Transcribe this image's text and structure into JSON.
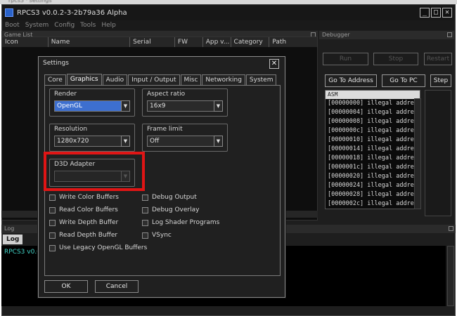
{
  "window": {
    "title": "RPCS3 v0.0.2-3-2b79a36 Alpha",
    "buttons": [
      "_",
      "□",
      "✕"
    ]
  },
  "menu": [
    "Boot",
    "System",
    "Config",
    "Tools",
    "Help"
  ],
  "game_list": {
    "header": "Game List",
    "columns": [
      "Icon",
      "Name",
      "Serial",
      "FW",
      "App v...",
      "Category",
      "Path"
    ]
  },
  "debugger": {
    "header": "Debugger",
    "run_label": "Run",
    "stop_label": "Stop",
    "restart_label": "Restart",
    "goto_address_label": "Go To Address",
    "goto_pc_label": "Go To PC",
    "step_label": "Step",
    "asm_header": "ASM",
    "asm_rows": [
      "[00000000] illegal addre",
      "[00000004] illegal addre",
      "[00000008] illegal addre",
      "[0000000c] illegal addre",
      "[00000010] illegal addre",
      "[00000014] illegal addre",
      "[00000018] illegal addre",
      "[0000001c] illegal addre",
      "[00000020] illegal addre",
      "[00000024] illegal addre",
      "[00000028] illegal addre",
      "[0000002c] illegal addre"
    ]
  },
  "log": {
    "header": "Log",
    "tab_label": "Log",
    "line": "RPCS3 v0.0.2"
  },
  "settings": {
    "title": "Settings",
    "close": "✕",
    "tabs": [
      "Core",
      "Graphics",
      "Audio",
      "Input / Output",
      "Misc",
      "Networking",
      "System"
    ],
    "active_tab": "Graphics",
    "render": {
      "label": "Render",
      "value": "OpenGL"
    },
    "aspect_ratio": {
      "label": "Aspect ratio",
      "value": "16x9"
    },
    "resolution": {
      "label": "Resolution",
      "value": "1280x720"
    },
    "frame_limit": {
      "label": "Frame limit",
      "value": "Off"
    },
    "d3d_adapter": {
      "label": "D3D Adapter",
      "value": ""
    },
    "checkboxes_left": [
      "Write Color Buffers",
      "Read Color Buffers",
      "Write Depth Buffer",
      "Read Depth Buffer",
      "Use Legacy OpenGL Buffers"
    ],
    "checkboxes_right": [
      "Debug Output",
      "Debug Overlay",
      "Log Shader Programs",
      "VSync"
    ],
    "ok_label": "OK",
    "cancel_label": "Cancel"
  },
  "colors": {
    "highlight": "#e01515",
    "selection": "#3d6fcf",
    "log_text": "#42d4c8"
  }
}
